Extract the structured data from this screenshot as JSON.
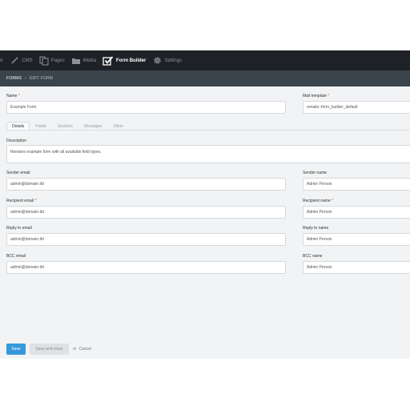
{
  "nav": {
    "partial": "d",
    "items": [
      {
        "label": "CMS",
        "icon": "wand-icon"
      },
      {
        "label": "Pages",
        "icon": "pages-icon"
      },
      {
        "label": "Media",
        "icon": "folder-icon"
      },
      {
        "label": "Form Builder",
        "icon": "checkbox-icon",
        "active": true
      },
      {
        "label": "Settings",
        "icon": "gear-icon"
      }
    ]
  },
  "breadcrumb": {
    "first": "FORMS",
    "separator": "›",
    "current": "EDIT FORM"
  },
  "form": {
    "name": {
      "label": "Name",
      "required": "*",
      "value": "Example Form"
    },
    "mail_template": {
      "label": "Mail template",
      "required": "*",
      "value": "renatio::form_builder_default"
    },
    "tabs": [
      "Details",
      "Fields",
      "Sections",
      "Messages",
      "Other"
    ],
    "description": {
      "label": "Description",
      "value": "Renders example form with all available field types."
    },
    "sender_email": {
      "label": "Sender email",
      "value": "admin@domain.tld"
    },
    "sender_name": {
      "label": "Sender name",
      "value": "Admin Person"
    },
    "recipient_email": {
      "label": "Recipient email",
      "required": "*",
      "value": "admin@domain.tld"
    },
    "recipient_name": {
      "label": "Recipient name",
      "required": "*",
      "value": "Admin Person"
    },
    "reply_to_email": {
      "label": "Reply to email",
      "value": "admin@domain.tld"
    },
    "reply_to_name": {
      "label": "Reply to name",
      "value": "Admin Person"
    },
    "bcc_email": {
      "label": "BCC email",
      "value": "admin@domain.tld"
    },
    "bcc_name": {
      "label": "BCC name",
      "value": "Admin Person"
    }
  },
  "actions": {
    "save": "Save",
    "save_close": "Save and close",
    "or": "or",
    "cancel": "Cancel"
  },
  "colors": {
    "nav_bg": "#1e2227",
    "breadcrumb_bg": "#3b444d",
    "primary": "#3498db",
    "required": "#d9534f"
  }
}
